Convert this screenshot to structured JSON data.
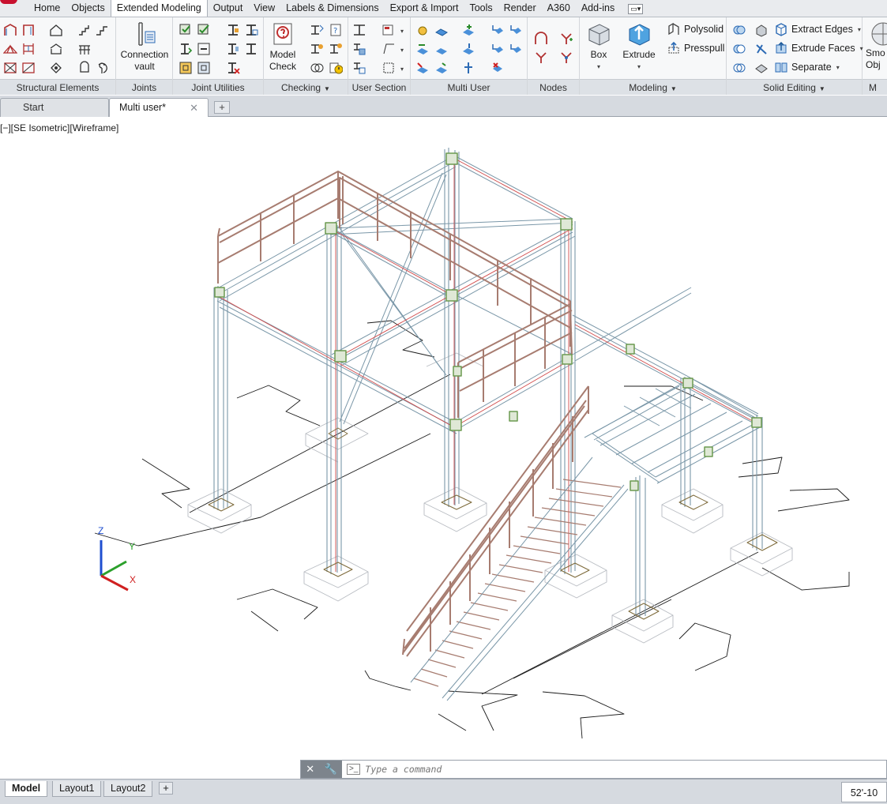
{
  "ribbon": {
    "tabs": [
      "Home",
      "Objects",
      "Extended Modeling",
      "Output",
      "View",
      "Labels & Dimensions",
      "Export & Import",
      "Tools",
      "Render",
      "A360",
      "Add-ins"
    ],
    "active_tab": "Extended Modeling",
    "panels": {
      "structural_elements": "Structural Elements",
      "joints": "Joints",
      "joint_utilities": "Joint Utilities",
      "checking": "Checking",
      "user_section": "User Section",
      "multi_user": "Multi User",
      "nodes": "Nodes",
      "modeling": "Modeling",
      "solid_editing": "Solid Editing",
      "cut": "M"
    },
    "buttons": {
      "connection_vault_1": "Connection",
      "connection_vault_2": "vault",
      "model_check_1": "Model",
      "model_check_2": "Check",
      "box": "Box",
      "extrude": "Extrude",
      "polysolid": "Polysolid",
      "presspull": "Presspull",
      "extract_edges": "Extract Edges",
      "extrude_faces": "Extrude Faces",
      "separate": "Separate",
      "smooth_1": "Smo",
      "smooth_2": "Obj"
    }
  },
  "doc_tabs": {
    "start": "Start",
    "active": "Multi user*",
    "close_glyph": "✕",
    "add_glyph": "+"
  },
  "viewport": {
    "label": "[−][SE Isometric][Wireframe]",
    "ucs": {
      "x": "X",
      "y": "Y",
      "z": "Z"
    }
  },
  "command_line": {
    "placeholder": "Type a command",
    "prompt_glyph": ">_"
  },
  "layout_tabs": [
    "Model",
    "Layout1",
    "Layout2"
  ],
  "active_layout": "Model",
  "status": {
    "coordinate": "52'-10"
  },
  "colors": {
    "steel_blue": "#7a97a8",
    "rail_brown": "#a77c70",
    "red_line": "#d24a4a",
    "node_green": "#6c9a50"
  }
}
